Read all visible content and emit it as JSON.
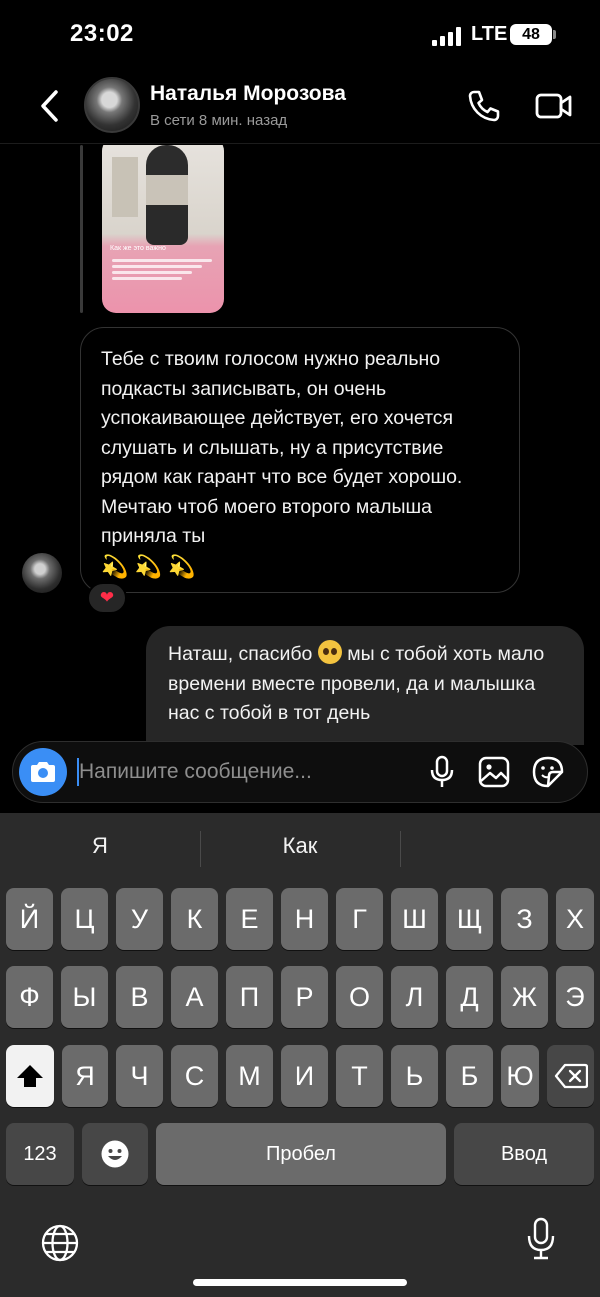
{
  "status_bar": {
    "time": "23:02",
    "network": "LTE",
    "battery": "48"
  },
  "header": {
    "contact_name": "Наталья Морозова",
    "contact_status": "В сети 8 мин. назад"
  },
  "story_reply": {
    "caption": "Как же это важно"
  },
  "messages": {
    "incoming_text": "Тебе с твоим голосом нужно реально подкасты записывать, он очень успокаивающее действует, его хочется слушать и слышать, ну а присутствие рядом как гарант что все будет хорошо. Мечтаю чтоб моего второго малыша приняла ты",
    "incoming_emojis": "💫 💫 💫",
    "incoming_reaction": "❤",
    "outgoing_before": "Наташ, спасибо",
    "outgoing_after": "мы с тобой хоть мало времени вместе провели, да и малышка нас с тобой в тот день"
  },
  "composer": {
    "placeholder": "Напишите сообщение..."
  },
  "keyboard": {
    "suggestions": [
      "Я",
      "Как",
      ""
    ],
    "row1": [
      "Й",
      "Ц",
      "У",
      "К",
      "Е",
      "Н",
      "Г",
      "Ш",
      "Щ",
      "З",
      "Х"
    ],
    "row2": [
      "Ф",
      "Ы",
      "В",
      "А",
      "П",
      "Р",
      "О",
      "Л",
      "Д",
      "Ж",
      "Э"
    ],
    "row3": [
      "Я",
      "Ч",
      "С",
      "М",
      "И",
      "Т",
      "Ь",
      "Б",
      "Ю"
    ],
    "numbers_label": "123",
    "space_label": "Пробел",
    "return_label": "Ввод"
  },
  "colors": {
    "accent": "#3a8ef5",
    "bubble_out": "#262626",
    "keyboard_bg": "#2b2b2b",
    "key": "#6b6b6b"
  }
}
